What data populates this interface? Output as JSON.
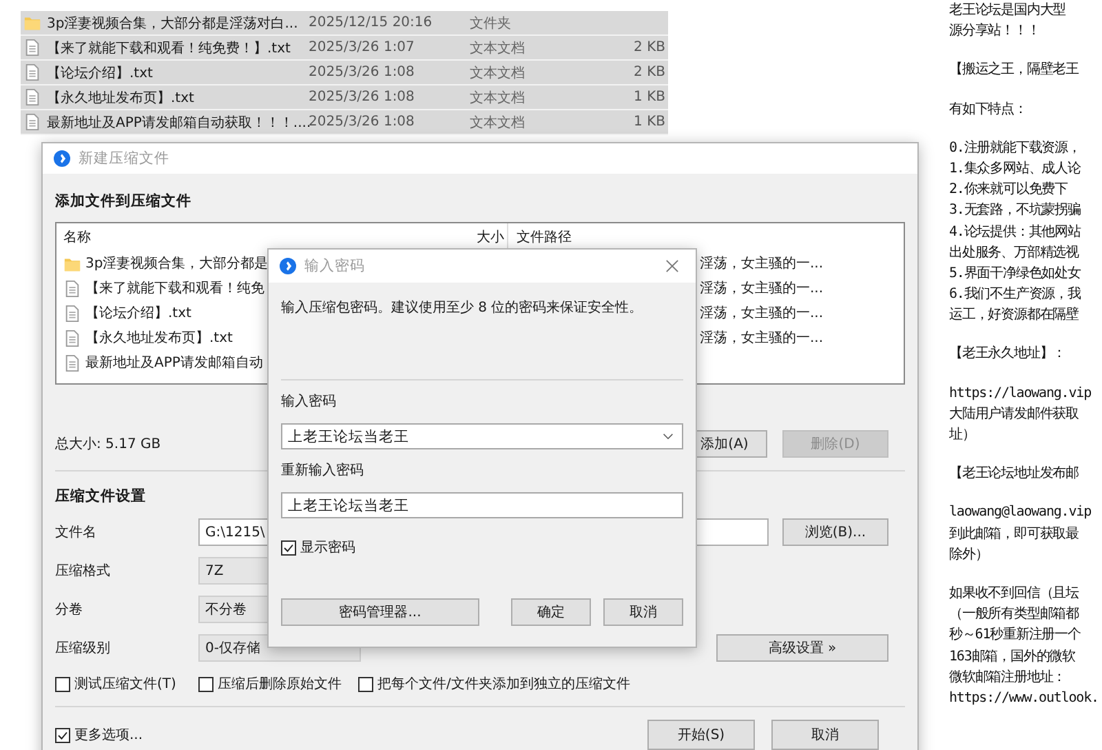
{
  "explorer": {
    "rows": [
      {
        "kind": "folder",
        "name": "3p淫妻视频合集，大部分都是淫荡对白...",
        "date": "2025/12/15 20:16",
        "type": "文件夹"
      },
      {
        "kind": "file",
        "name": "【来了就能下载和观看！纯免费！】.txt",
        "date": "2025/3/26 1:07",
        "type": "文本文档",
        "size": "2 KB"
      },
      {
        "kind": "file",
        "name": "【论坛介绍】.txt",
        "date": "2025/3/26 1:08",
        "type": "文本文档",
        "size": "2 KB"
      },
      {
        "kind": "file",
        "name": "【永久地址发布页】.txt",
        "date": "2025/3/26 1:08",
        "type": "文本文档",
        "size": "1 KB"
      },
      {
        "kind": "file",
        "name": "最新地址及APP请发邮箱自动获取！！！....",
        "date": "2025/3/26 1:08",
        "type": "文本文档",
        "size": "1 KB"
      }
    ]
  },
  "document": {
    "blocks": [
      [
        "老王论坛是国内大型",
        "源分享站！！！"
      ],
      [
        "【搬运之王，隔壁老王"
      ],
      [
        "有如下特点："
      ],
      [
        "0.注册就能下载资源，",
        "1.集众多网站、成人论",
        "2.你来就可以免费下",
        "3.无套路，不坑蒙拐骗",
        "4.论坛提供：其他网站",
        "出处服务、万部精选视",
        "5.界面干净绿色如处女",
        "6.我们不生产资源，我",
        "运工，好资源都在隔壁"
      ],
      [
        "【老王永久地址】："
      ],
      [
        "https://laowang.vip",
        "大陆用户请发邮件获取",
        "址）"
      ],
      [
        "【老王论坛地址发布邮"
      ],
      [
        "laowang@laowang.vip",
        "到此邮箱，即可获取最",
        "除外）"
      ],
      [
        "如果收不到回信（且坛",
        "（一般所有类型邮箱都",
        "秒～61秒重新注册一个",
        "163邮箱，国外的微软",
        "微软邮箱注册地址：",
        "https://www.outlook."
      ]
    ]
  },
  "archive_dialog": {
    "title": "新建压缩文件",
    "heading": "添加文件到压缩文件",
    "file_list": {
      "columns": [
        "名称",
        "大小",
        "文件路径"
      ],
      "rows": [
        {
          "kind": "folder",
          "name": "3p淫妻视频合集，大部分都是",
          "path": "淫荡，女主骚的一..."
        },
        {
          "kind": "file",
          "name": "【来了就能下载和观看！纯免",
          "path": "淫荡，女主骚的一..."
        },
        {
          "kind": "file",
          "name": "【论坛介绍】.txt",
          "path": "淫荡，女主骚的一..."
        },
        {
          "kind": "file",
          "name": "【永久地址发布页】.txt",
          "path": "淫荡，女主骚的一..."
        },
        {
          "kind": "file",
          "name": "最新地址及APP请发邮箱自动"
        }
      ]
    },
    "total_size": "总大小: 5.17 GB",
    "list_buttons": [
      {
        "label": "添加(A)",
        "disabled": false
      },
      {
        "label": "删除(D)",
        "disabled": true
      }
    ],
    "settings_heading": "压缩文件设置",
    "filename": {
      "label": "文件名",
      "value": "G:\\1215\\"
    },
    "browse_button": "浏览(B)...",
    "format": {
      "label": "压缩格式",
      "value": "7Z"
    },
    "split": {
      "label": "分卷",
      "value": "不分卷"
    },
    "level": {
      "label": "压缩级别",
      "value": "0-仅存储"
    },
    "advanced_button": "高级设置 »",
    "options": [
      {
        "label": "测试压缩文件(T)",
        "checked": false
      },
      {
        "label": "压缩后删除原始文件",
        "checked": false
      },
      {
        "label": "把每个文件/文件夹添加到独立的压缩文件",
        "checked": false
      }
    ],
    "more_options": {
      "label": "更多选项...",
      "checked": true
    },
    "buttons": [
      "开始(S)",
      "取消"
    ]
  },
  "password_dialog": {
    "title": "输入密码",
    "description": "输入压缩包密码。建议使用至少 8 位的密码来保证安全性。",
    "password": {
      "label": "输入密码",
      "value": "上老王论坛当老王"
    },
    "confirm": {
      "label": "重新输入密码",
      "value": "上老王论坛当老王"
    },
    "show_password": {
      "label": "显示密码",
      "checked": true
    },
    "buttons": [
      "密码管理器...",
      "确定",
      "取消"
    ]
  }
}
